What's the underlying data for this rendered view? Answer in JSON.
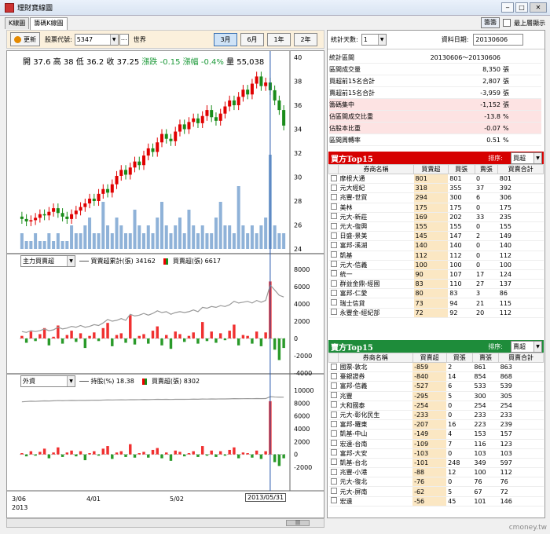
{
  "window": {
    "title": "理財寶線圖"
  },
  "tabs": [
    "K線圖",
    "籌碼K線圖"
  ],
  "top_right": {
    "button": "籌籌",
    "topmost_label": "最上層顯示"
  },
  "toolbar": {
    "refresh_label": "更新",
    "stock_label": "股票代號:",
    "stock_value": "5347",
    "stock_name": "世界",
    "ranges": [
      "3月",
      "6月",
      "1年",
      "2年"
    ],
    "active_range": "3月"
  },
  "price_info": {
    "open_label": "開",
    "open": "37.6",
    "high_label": "高",
    "high": "38",
    "low_label": "低",
    "low": "36.2",
    "close_label": "收",
    "close": "37.25",
    "chg_label": "漲跌",
    "chg": "-0.15",
    "pct_label": "漲幅",
    "pct": "-0.4%",
    "vol_label": "量",
    "vol": "55,038"
  },
  "panel2": {
    "combo": "主力買賣超",
    "legend1": "買賣超累計(張) 34162",
    "legend2": "買賣超(張) 6617"
  },
  "panel3": {
    "combo": "外資",
    "legend1": "持股(%) 18.38",
    "legend2": "買賣超(張) 8302"
  },
  "axis": {
    "dates": [
      "3/06",
      "4/01",
      "5/02"
    ],
    "year": "2013",
    "cursor_date": "2013/05/31"
  },
  "chart_data": [
    {
      "type": "candlestick",
      "ylim": [
        24,
        40
      ],
      "yticks": [
        24,
        26,
        28,
        30,
        32,
        34,
        36,
        38,
        40
      ],
      "closes": [
        26.5,
        26.3,
        26.4,
        26.6,
        26.9,
        26.8,
        27.1,
        27.4,
        27.0,
        26.7,
        26.5,
        26.9,
        27.2,
        27.5,
        27.8,
        28.2,
        28.0,
        28.6,
        29.0,
        28.7,
        29.4,
        30.1,
        30.6,
        30.2,
        30.8,
        31.3,
        31.0,
        31.8,
        32.4,
        32.1,
        32.9,
        33.6,
        33.2,
        33.0,
        33.8,
        34.4,
        34.0,
        34.6,
        34.9,
        34.5,
        35.1,
        35.6,
        35.0,
        34.7,
        35.3,
        35.9,
        36.4,
        36.0,
        36.7,
        37.3,
        36.9,
        37.8,
        38.4,
        37.6,
        37.9,
        37.25,
        36.4,
        35.6,
        34.3
      ],
      "volumes": [
        2,
        1,
        1,
        2,
        1,
        1,
        2,
        1,
        2,
        1,
        1,
        3,
        2,
        2,
        3,
        4,
        2,
        2,
        6,
        3,
        2,
        4,
        3,
        2,
        2,
        5,
        3,
        2,
        3,
        2,
        4,
        6,
        3,
        2,
        3,
        4,
        2,
        5,
        3,
        2,
        3,
        2,
        2,
        4,
        6,
        3,
        3,
        2,
        8,
        3,
        2,
        3,
        2,
        3,
        4,
        12,
        3,
        2,
        2
      ]
    },
    {
      "type": "bar+line",
      "name": "主力買賣超",
      "ylim": [
        -4000,
        8000
      ],
      "yticks": [
        -4000,
        -2000,
        0,
        2000,
        4000,
        6000,
        8000
      ],
      "bars": [
        300,
        -500,
        800,
        -300,
        500,
        1200,
        -800,
        200,
        1500,
        -600,
        400,
        900,
        -400,
        600,
        -1100,
        300,
        700,
        -300,
        1200,
        1800,
        -900,
        400,
        600,
        -500,
        2700,
        -700,
        300,
        500,
        -600,
        900,
        1400,
        -800,
        400,
        -1200,
        800,
        500,
        -400,
        300,
        700,
        -600,
        1900,
        -300,
        800,
        -500,
        600,
        -200,
        900,
        1600,
        -800,
        400,
        300,
        -600,
        800,
        -900,
        700,
        6600,
        -1300,
        -2500,
        -1100
      ],
      "line": [
        800,
        700,
        900,
        800,
        900,
        1100,
        900,
        1000,
        1300,
        1100,
        1200,
        1400,
        1300,
        1500,
        1300,
        1400,
        1600,
        1500,
        1800,
        2200,
        2000,
        2100,
        2300,
        2100,
        2800,
        2600,
        2700,
        2900,
        2700,
        2900,
        3200,
        3000,
        3100,
        2800,
        3000,
        3100,
        3000,
        3100,
        3300,
        3100,
        3600,
        3500,
        3700,
        3600,
        3800,
        3700,
        3900,
        4300,
        4100,
        4200,
        4300,
        4100,
        4400,
        4200,
        4400,
        6200,
        5600,
        5000,
        4800
      ]
    },
    {
      "type": "bar+line",
      "name": "外資",
      "ylim": [
        -2000,
        10000
      ],
      "yticks": [
        -2000,
        0,
        2000,
        4000,
        6000,
        8000,
        10000
      ],
      "bars": [
        200,
        -300,
        500,
        -200,
        400,
        900,
        -600,
        300,
        1100,
        -400,
        300,
        600,
        -300,
        500,
        -900,
        200,
        500,
        -200,
        900,
        1300,
        -700,
        300,
        500,
        -400,
        1600,
        -500,
        200,
        400,
        -500,
        700,
        1000,
        -600,
        300,
        -1000,
        600,
        400,
        -300,
        200,
        500,
        -400,
        1300,
        -200,
        600,
        -400,
        500,
        -200,
        700,
        1100,
        -600,
        300,
        200,
        -500,
        600,
        -700,
        500,
        8300,
        -1200,
        -1800,
        -600
      ],
      "line": [
        8200,
        8250,
        8300,
        8280,
        8320,
        8350,
        8330,
        8360,
        8400,
        8380,
        8400,
        8420,
        8410,
        8430,
        8420,
        8440,
        8460,
        8450,
        8480,
        8500,
        8490,
        8510,
        8520,
        8510,
        8540,
        8530,
        8540,
        8560,
        8550,
        8570,
        8590,
        8580,
        8590,
        8570,
        8590,
        8600,
        8590,
        8600,
        8620,
        8610,
        8640,
        8630,
        8650,
        8640,
        8660,
        8650,
        8670,
        8700,
        8680,
        8690,
        8700,
        8690,
        8710,
        8700,
        8710,
        9000,
        8950,
        8930,
        8920
      ]
    }
  ],
  "stats": {
    "days_label": "統計天數:",
    "days_value": "1",
    "date_label": "資料日期:",
    "date_value": "20130606",
    "rows": [
      {
        "k": "統計區間",
        "v": "20130606～20130606",
        "u": "",
        "pink": false
      },
      {
        "k": "區間成交量",
        "v": "8,350",
        "u": "張",
        "pink": false
      },
      {
        "k": "買超前15名合計",
        "v": "2,807",
        "u": "張",
        "pink": false
      },
      {
        "k": "賣超前15名合計",
        "v": "-3,959",
        "u": "張",
        "pink": false
      },
      {
        "k": "籌碼集中",
        "v": "-1,152",
        "u": "張",
        "pink": true
      },
      {
        "k": "佔區間成交比重",
        "v": "-13.8",
        "u": "%",
        "pink": true
      },
      {
        "k": "佔股本比重",
        "v": "-0.07",
        "u": "%",
        "pink": true
      },
      {
        "k": "區間周轉率",
        "v": "0.51",
        "u": "%",
        "pink": false
      }
    ]
  },
  "buy_top15": {
    "title": "買方Top15",
    "sort_label": "排序:",
    "sort_value": "買超",
    "color": "#d60000",
    "headers": [
      "券商名稱",
      "買賣超",
      "買張",
      "賣張",
      "買賣合計"
    ],
    "rows": [
      [
        "摩根大通",
        "801",
        "801",
        "0",
        "801"
      ],
      [
        "元大經紀",
        "318",
        "355",
        "37",
        "392"
      ],
      [
        "兆豐-世貿",
        "294",
        "300",
        "6",
        "306"
      ],
      [
        "美林",
        "175",
        "175",
        "0",
        "175"
      ],
      [
        "元大-新莊",
        "169",
        "202",
        "33",
        "235"
      ],
      [
        "元大-復興",
        "155",
        "155",
        "0",
        "155"
      ],
      [
        "日盛-景美",
        "145",
        "147",
        "2",
        "149"
      ],
      [
        "富邦-溪湖",
        "140",
        "140",
        "0",
        "140"
      ],
      [
        "凱基",
        "112",
        "112",
        "0",
        "112"
      ],
      [
        "元大-信義",
        "100",
        "100",
        "0",
        "100"
      ],
      [
        "統一",
        "90",
        "107",
        "17",
        "124"
      ],
      [
        "群益金鼎-經國",
        "83",
        "110",
        "27",
        "137"
      ],
      [
        "富邦-仁愛",
        "80",
        "83",
        "3",
        "86"
      ],
      [
        "瑞士信貸",
        "73",
        "94",
        "21",
        "115"
      ],
      [
        "永豐金-經紀部",
        "72",
        "92",
        "20",
        "112"
      ]
    ]
  },
  "sell_top15": {
    "title": "賣方Top15",
    "sort_label": "排序:",
    "sort_value": "賣超",
    "color": "#1e8c3a",
    "headers": [
      "券商名稱",
      "買賣超",
      "買張",
      "賣張",
      "買賣合計"
    ],
    "rows": [
      [
        "國票-敦北",
        "-859",
        "2",
        "861",
        "863"
      ],
      [
        "臺銀證券",
        "-840",
        "14",
        "854",
        "868"
      ],
      [
        "富邦-信義",
        "-527",
        "6",
        "533",
        "539"
      ],
      [
        "兆豐",
        "-295",
        "5",
        "300",
        "305"
      ],
      [
        "大和國泰",
        "-254",
        "0",
        "254",
        "254"
      ],
      [
        "元大-彰化民生",
        "-233",
        "0",
        "233",
        "233"
      ],
      [
        "富邦-羅東",
        "-207",
        "16",
        "223",
        "239"
      ],
      [
        "凱基-中山",
        "-149",
        "4",
        "153",
        "157"
      ],
      [
        "宏遠-台南",
        "-109",
        "7",
        "116",
        "123"
      ],
      [
        "富邦-大安",
        "-103",
        "0",
        "103",
        "103"
      ],
      [
        "凱基-台北",
        "-101",
        "248",
        "349",
        "597"
      ],
      [
        "兆豐-小港",
        "-88",
        "12",
        "100",
        "112"
      ],
      [
        "元大-復北",
        "-76",
        "0",
        "76",
        "76"
      ],
      [
        "元大-屏南",
        "-62",
        "5",
        "67",
        "72"
      ],
      [
        "宏遠",
        "-56",
        "45",
        "101",
        "146"
      ]
    ]
  },
  "watermark": "cmoney.tw"
}
